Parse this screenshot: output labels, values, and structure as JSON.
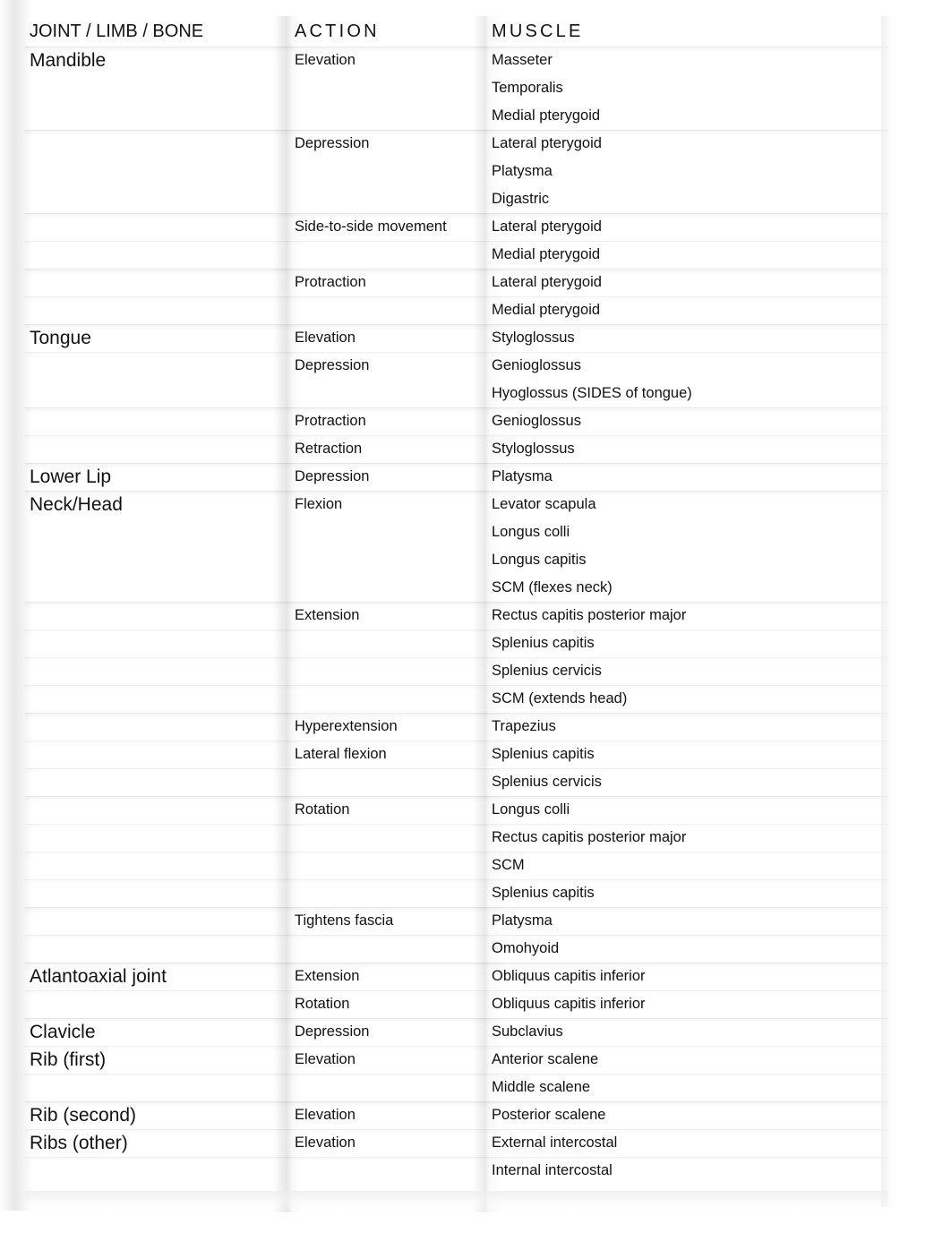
{
  "document": {
    "title": "Joint / Limb / Bone — Action — Muscle reference table"
  },
  "table": {
    "headers": {
      "joint": "JOINT / LIMB / BONE",
      "action": "ACTION",
      "muscle": "MUSCLE"
    },
    "rows": [
      {
        "joint": "Mandible",
        "action": "Elevation",
        "muscle": "Masseter",
        "band": "strong"
      },
      {
        "joint": "",
        "action": "",
        "muscle": "Temporalis",
        "band": "none"
      },
      {
        "joint": "",
        "action": "",
        "muscle": "Medial pterygoid",
        "band": "none"
      },
      {
        "joint": "",
        "action": "Depression",
        "muscle": "Lateral pterygoid",
        "band": "strong"
      },
      {
        "joint": "",
        "action": "",
        "muscle": "Platysma",
        "band": "none"
      },
      {
        "joint": "",
        "action": "",
        "muscle": "Digastric",
        "band": "none"
      },
      {
        "joint": "",
        "action": "Side-to-side movement",
        "muscle": "Lateral pterygoid",
        "band": "strong"
      },
      {
        "joint": "",
        "action": "",
        "muscle": "Medial pterygoid",
        "band": "light"
      },
      {
        "joint": "",
        "action": "Protraction",
        "muscle": "Lateral pterygoid",
        "band": "strong"
      },
      {
        "joint": "",
        "action": "",
        "muscle": "Medial pterygoid",
        "band": "light"
      },
      {
        "joint": "Tongue",
        "action": "Elevation",
        "muscle": "Styloglossus",
        "band": "strong"
      },
      {
        "joint": "",
        "action": "Depression",
        "muscle": "Genioglossus",
        "band": "light"
      },
      {
        "joint": "",
        "action": "",
        "muscle": "Hyoglossus (SIDES of tongue)",
        "band": "none"
      },
      {
        "joint": "",
        "action": "Protraction",
        "muscle": "Genioglossus",
        "band": "strong"
      },
      {
        "joint": "",
        "action": "Retraction",
        "muscle": "Styloglossus",
        "band": "light"
      },
      {
        "joint": "Lower Lip",
        "action": "Depression",
        "muscle": "Platysma",
        "band": "strong"
      },
      {
        "joint": "Neck/Head",
        "action": "Flexion",
        "muscle": "Levator scapula",
        "band": "strong"
      },
      {
        "joint": "",
        "action": "",
        "muscle": "Longus colli",
        "band": "none"
      },
      {
        "joint": "",
        "action": "",
        "muscle": "Longus capitis",
        "band": "none"
      },
      {
        "joint": "",
        "action": "",
        "muscle": "SCM (flexes neck)",
        "band": "none"
      },
      {
        "joint": "",
        "action": "Extension",
        "muscle": "Rectus capitis posterior major",
        "band": "strong"
      },
      {
        "joint": "",
        "action": "",
        "muscle": "Splenius capitis",
        "band": "light"
      },
      {
        "joint": "",
        "action": "",
        "muscle": "Splenius cervicis",
        "band": "light"
      },
      {
        "joint": "",
        "action": "",
        "muscle": "SCM (extends head)",
        "band": "light"
      },
      {
        "joint": "",
        "action": "Hyperextension",
        "muscle": "Trapezius",
        "band": "strong"
      },
      {
        "joint": "",
        "action": "Lateral flexion",
        "muscle": "Splenius capitis",
        "band": "light"
      },
      {
        "joint": "",
        "action": "",
        "muscle": "Splenius cervicis",
        "band": "light"
      },
      {
        "joint": "",
        "action": "Rotation",
        "muscle": "Longus colli",
        "band": "strong"
      },
      {
        "joint": "",
        "action": "",
        "muscle": "Rectus capitis posterior major",
        "band": "light"
      },
      {
        "joint": "",
        "action": "",
        "muscle": "SCM",
        "band": "light"
      },
      {
        "joint": "",
        "action": "",
        "muscle": "Splenius capitis",
        "band": "light"
      },
      {
        "joint": "",
        "action": "Tightens fascia",
        "muscle": "Platysma",
        "band": "strong"
      },
      {
        "joint": "",
        "action": "",
        "muscle": "Omohyoid",
        "band": "light"
      },
      {
        "joint": "Atlantoaxial joint",
        "action": "Extension",
        "muscle": "Obliquus capitis inferior",
        "band": "strong"
      },
      {
        "joint": "",
        "action": "Rotation",
        "muscle": "Obliquus capitis inferior",
        "band": "light"
      },
      {
        "joint": "Clavicle",
        "action": "Depression",
        "muscle": "Subclavius",
        "band": "strong"
      },
      {
        "joint": "Rib (first)",
        "action": "Elevation",
        "muscle": "Anterior scalene",
        "band": "light"
      },
      {
        "joint": "",
        "action": "",
        "muscle": "Middle scalene",
        "band": "light"
      },
      {
        "joint": "Rib (second)",
        "action": "Elevation",
        "muscle": "Posterior scalene",
        "band": "strong"
      },
      {
        "joint": "Ribs (other)",
        "action": "Elevation",
        "muscle": "External intercostal",
        "band": "light"
      },
      {
        "joint": "",
        "action": "",
        "muscle": "Internal intercostal",
        "band": "light"
      },
      {
        "joint": "",
        "action": "",
        "muscle": "",
        "band": "none"
      }
    ]
  }
}
